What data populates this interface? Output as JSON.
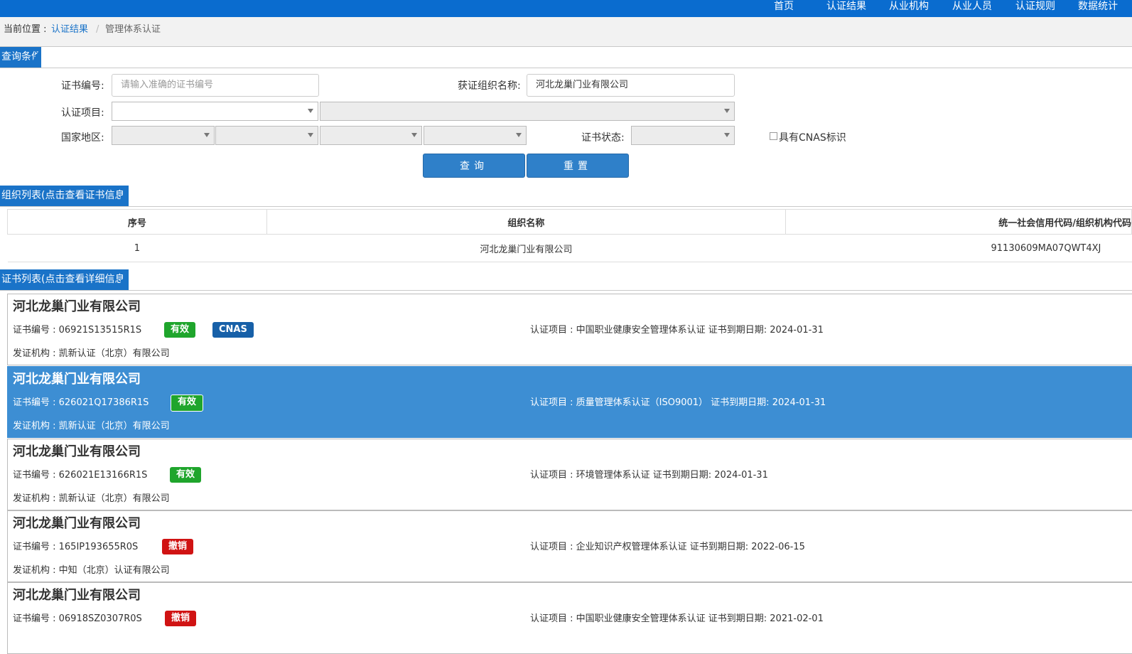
{
  "nav": {
    "items": [
      "首页",
      "认证结果",
      "从业机构",
      "从业人员",
      "认证规则",
      "数据统计"
    ]
  },
  "breadcrumb": {
    "label": "当前位置 :",
    "link": "认证结果",
    "separator": "/",
    "current": "管理体系认证"
  },
  "query": {
    "section_title": "查询条件",
    "cert_no_label": "证书编号:",
    "cert_no_placeholder": "请输入准确的证书编号",
    "org_name_label": "获证组织名称:",
    "org_name_value": "河北龙巢门业有限公司",
    "project_label": "认证项目:",
    "region_label": "国家地区:",
    "status_label": "证书状态:",
    "cnas_label": "具有CNAS标识",
    "search_button": "查询",
    "reset_button": "重置"
  },
  "org_list": {
    "section_title": "组织列表(点击查看证书信息)",
    "columns": [
      "序号",
      "组织名称",
      "统一社会信用代码/组织机构代码"
    ],
    "rows": [
      [
        "1",
        "河北龙巢门业有限公司",
        "91130609MA07QWT4XJ"
      ]
    ]
  },
  "cert_list": {
    "section_title": "证书列表(点击查看详细信息)",
    "cards": [
      {
        "org": "河北龙巢门业有限公司",
        "cert_no": "证书编号 : 06921S13515R1S",
        "status": "有效",
        "cnas": "CNAS",
        "project": "认证项目 : 中国职业健康安全管理体系认证   证书到期日期: 2024-01-31",
        "issuer": "发证机构 : 凯新认证（北京）有限公司"
      },
      {
        "org": "河北龙巢门业有限公司",
        "cert_no": "证书编号 : 626021Q17386R1S",
        "status": "有效",
        "project": "认证项目 : 质量管理体系认证（ISO9001）   证书到期日期: 2024-01-31",
        "issuer": "发证机构 : 凯新认证（北京）有限公司"
      },
      {
        "org": "河北龙巢门业有限公司",
        "cert_no": "证书编号 : 626021E13166R1S",
        "status": "有效",
        "project": "认证项目 : 环境管理体系认证   证书到期日期: 2024-01-31",
        "issuer": "发证机构 : 凯新认证（北京）有限公司"
      },
      {
        "org": "河北龙巢门业有限公司",
        "cert_no": "证书编号 : 165IP193655R0S",
        "status": "撤销",
        "project": "认证项目 : 企业知识产权管理体系认证   证书到期日期: 2022-06-15",
        "issuer": "发证机构 : 中知（北京）认证有限公司"
      },
      {
        "org": "河北龙巢门业有限公司",
        "cert_no": "证书编号 : 06918SZ0307R0S",
        "status": "撤销",
        "project": "认证项目 : 中国职业健康安全管理体系认证   证书到期日期: 2021-02-01",
        "issuer": ""
      }
    ]
  }
}
